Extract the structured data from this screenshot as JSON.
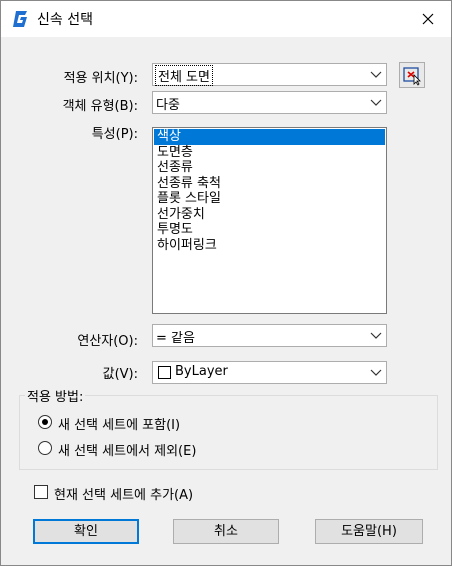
{
  "window": {
    "title": "신속 선택",
    "icon": "app-logo-icon",
    "close_icon": "close-icon"
  },
  "form": {
    "apply_to": {
      "label": "적용 위치(Y):",
      "value": "전체 도면"
    },
    "object_type": {
      "label": "객체 유형(B):",
      "value": "다중"
    },
    "properties": {
      "label": "특성(P):",
      "items": [
        "색상",
        "도면층",
        "선종류",
        "선종류 축척",
        "플롯 스타일",
        "선가중치",
        "투명도",
        "하이퍼링크"
      ],
      "selected_index": 0
    },
    "operator": {
      "label": "연산자(O):",
      "value": "= 같음"
    },
    "value": {
      "label": "값(V):",
      "value": "ByLayer",
      "swatch_color": "#ffffff"
    }
  },
  "apply_method": {
    "title": "적용 방법:",
    "options": [
      {
        "label": "새 선택 세트에 포함(I)",
        "checked": true
      },
      {
        "label": "새 선택 세트에서 제외(E)",
        "checked": false
      }
    ]
  },
  "append": {
    "label": "현재 선택 세트에 추가(A)",
    "checked": false
  },
  "buttons": {
    "ok": "확인",
    "cancel": "취소",
    "help": "도움말(H)"
  },
  "colors": {
    "accent": "#0078d7",
    "logo": "#1f6fd1"
  }
}
